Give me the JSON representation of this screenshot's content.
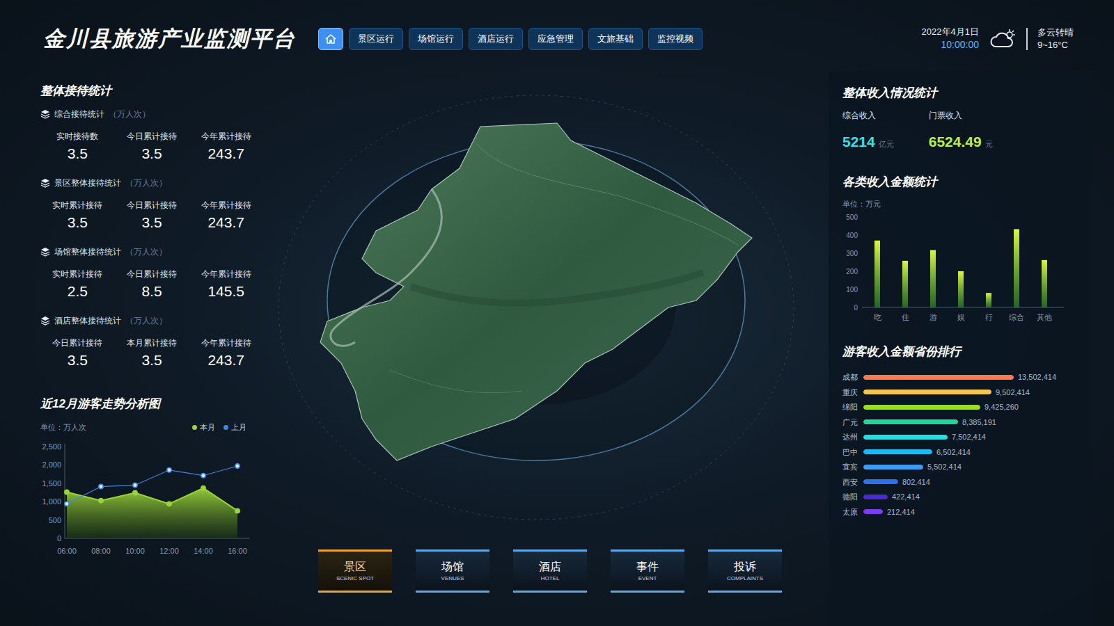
{
  "header": {
    "title": "金川县旅游产业监测平台",
    "date": "2022年4月1日",
    "time": "10:00:00",
    "weather": {
      "text": "多云转晴",
      "temp": "9~16°C"
    }
  },
  "nav": {
    "home": {
      "selected": true
    },
    "tabs": [
      {
        "label": "景区运行",
        "selected": false
      },
      {
        "label": "场馆运行",
        "selected": false
      },
      {
        "label": "酒店运行",
        "selected": false
      },
      {
        "label": "应急管理",
        "selected": false
      },
      {
        "label": "文旅基础",
        "selected": false
      },
      {
        "label": "监控视频",
        "selected": false
      }
    ]
  },
  "reception": {
    "title": "整体接待统计",
    "groups": [
      {
        "title": "综合接待统计",
        "unit": "（万人次）",
        "stats": [
          {
            "label": "实时接待数",
            "value": "3.5"
          },
          {
            "label": "今日累计接待",
            "value": "3.5"
          },
          {
            "label": "今年累计接待",
            "value": "243.7"
          }
        ]
      },
      {
        "title": "景区整体接待统计",
        "unit": "（万人次）",
        "stats": [
          {
            "label": "实时累计接待",
            "value": "3.5"
          },
          {
            "label": "今日累计接待",
            "value": "3.5"
          },
          {
            "label": "今年累计接待",
            "value": "243.7"
          }
        ]
      },
      {
        "title": "场馆整体接待统计",
        "unit": "（万人次）",
        "stats": [
          {
            "label": "实时累计接待",
            "value": "2.5"
          },
          {
            "label": "今日累计接待",
            "value": "8.5"
          },
          {
            "label": "今年累计接待",
            "value": "145.5"
          }
        ]
      },
      {
        "title": "酒店整体接待统计",
        "unit": "（万人次）",
        "stats": [
          {
            "label": "今日累计接待",
            "value": "3.5"
          },
          {
            "label": "本月累计接待",
            "value": "3.5"
          },
          {
            "label": "今年累计接待",
            "value": "243.7"
          }
        ]
      }
    ]
  },
  "trend": {
    "title": "近12月游客走势分析图",
    "unit": "单位：万人次",
    "y_ticks": [
      "2,500",
      "2,000",
      "1,500",
      "1,000",
      "500",
      "0"
    ],
    "x_ticks": [
      "06:00",
      "08:00",
      "10:00",
      "12:00",
      "14:00",
      "16:00"
    ],
    "series": [
      {
        "label": "本月",
        "color": "#9bd43a",
        "values": [
          1260,
          1030,
          1240,
          940,
          1370,
          750
        ]
      },
      {
        "label": "上月",
        "color": "#3f86e0",
        "values": [
          940,
          1410,
          1450,
          1860,
          1710,
          1970
        ]
      }
    ]
  },
  "income": {
    "title": "整体收入情况统计",
    "items": [
      {
        "label": "综合收入",
        "value": "5214",
        "unit": "亿元",
        "color": "#2fe3e8"
      },
      {
        "label": "门票收入",
        "value": "6524.49",
        "unit": "元",
        "color": "#b8f23e"
      }
    ]
  },
  "categories": {
    "title": "各类收入金额统计",
    "unit": "单位：万元",
    "y_ticks": [
      "500",
      "400",
      "300",
      "200",
      "100",
      "0"
    ],
    "bars": [
      {
        "label": "吃",
        "value": 370
      },
      {
        "label": "住",
        "value": 258
      },
      {
        "label": "游",
        "value": 317
      },
      {
        "label": "娱",
        "value": 200
      },
      {
        "label": "行",
        "value": 80
      },
      {
        "label": "综合",
        "value": 433
      },
      {
        "label": "其他",
        "value": 262
      }
    ]
  },
  "provinces": {
    "title": "游客收入金额省份排行",
    "items": [
      {
        "name": "成都",
        "value": "13,502,414",
        "level": 1.0,
        "color": "#f97a4f"
      },
      {
        "name": "重庆",
        "value": "9,502,414",
        "level": 0.85,
        "color": "#f6c452"
      },
      {
        "name": "绵阳",
        "value": "9,425,260",
        "level": 0.78,
        "color": "#9bdc24"
      },
      {
        "name": "广元",
        "value": "8,385,191",
        "level": 0.63,
        "color": "#23d59b"
      },
      {
        "name": "达州",
        "value": "7,502,414",
        "level": 0.56,
        "color": "#1fe2e2"
      },
      {
        "name": "巴中",
        "value": "6,502,414",
        "level": 0.46,
        "color": "#1db8f0"
      },
      {
        "name": "宜宾",
        "value": "5,502,414",
        "level": 0.4,
        "color": "#3d9bf2"
      },
      {
        "name": "西安",
        "value": "802,414",
        "level": 0.23,
        "color": "#2f6fe8"
      },
      {
        "name": "德阳",
        "value": "422,414",
        "level": 0.16,
        "color": "#4a2bd0"
      },
      {
        "name": "太原",
        "value": "212,414",
        "level": 0.13,
        "color": "#7b3cf0"
      }
    ]
  },
  "bottom_tabs": [
    {
      "label": "景区",
      "sub": "SCENIC SPOT",
      "selected": true
    },
    {
      "label": "场馆",
      "sub": "VENUES",
      "selected": false
    },
    {
      "label": "酒店",
      "sub": "HOTEL",
      "selected": false
    },
    {
      "label": "事件",
      "sub": "EVENT",
      "selected": false
    },
    {
      "label": "投诉",
      "sub": "COMPLAINTS",
      "selected": false
    }
  ]
}
